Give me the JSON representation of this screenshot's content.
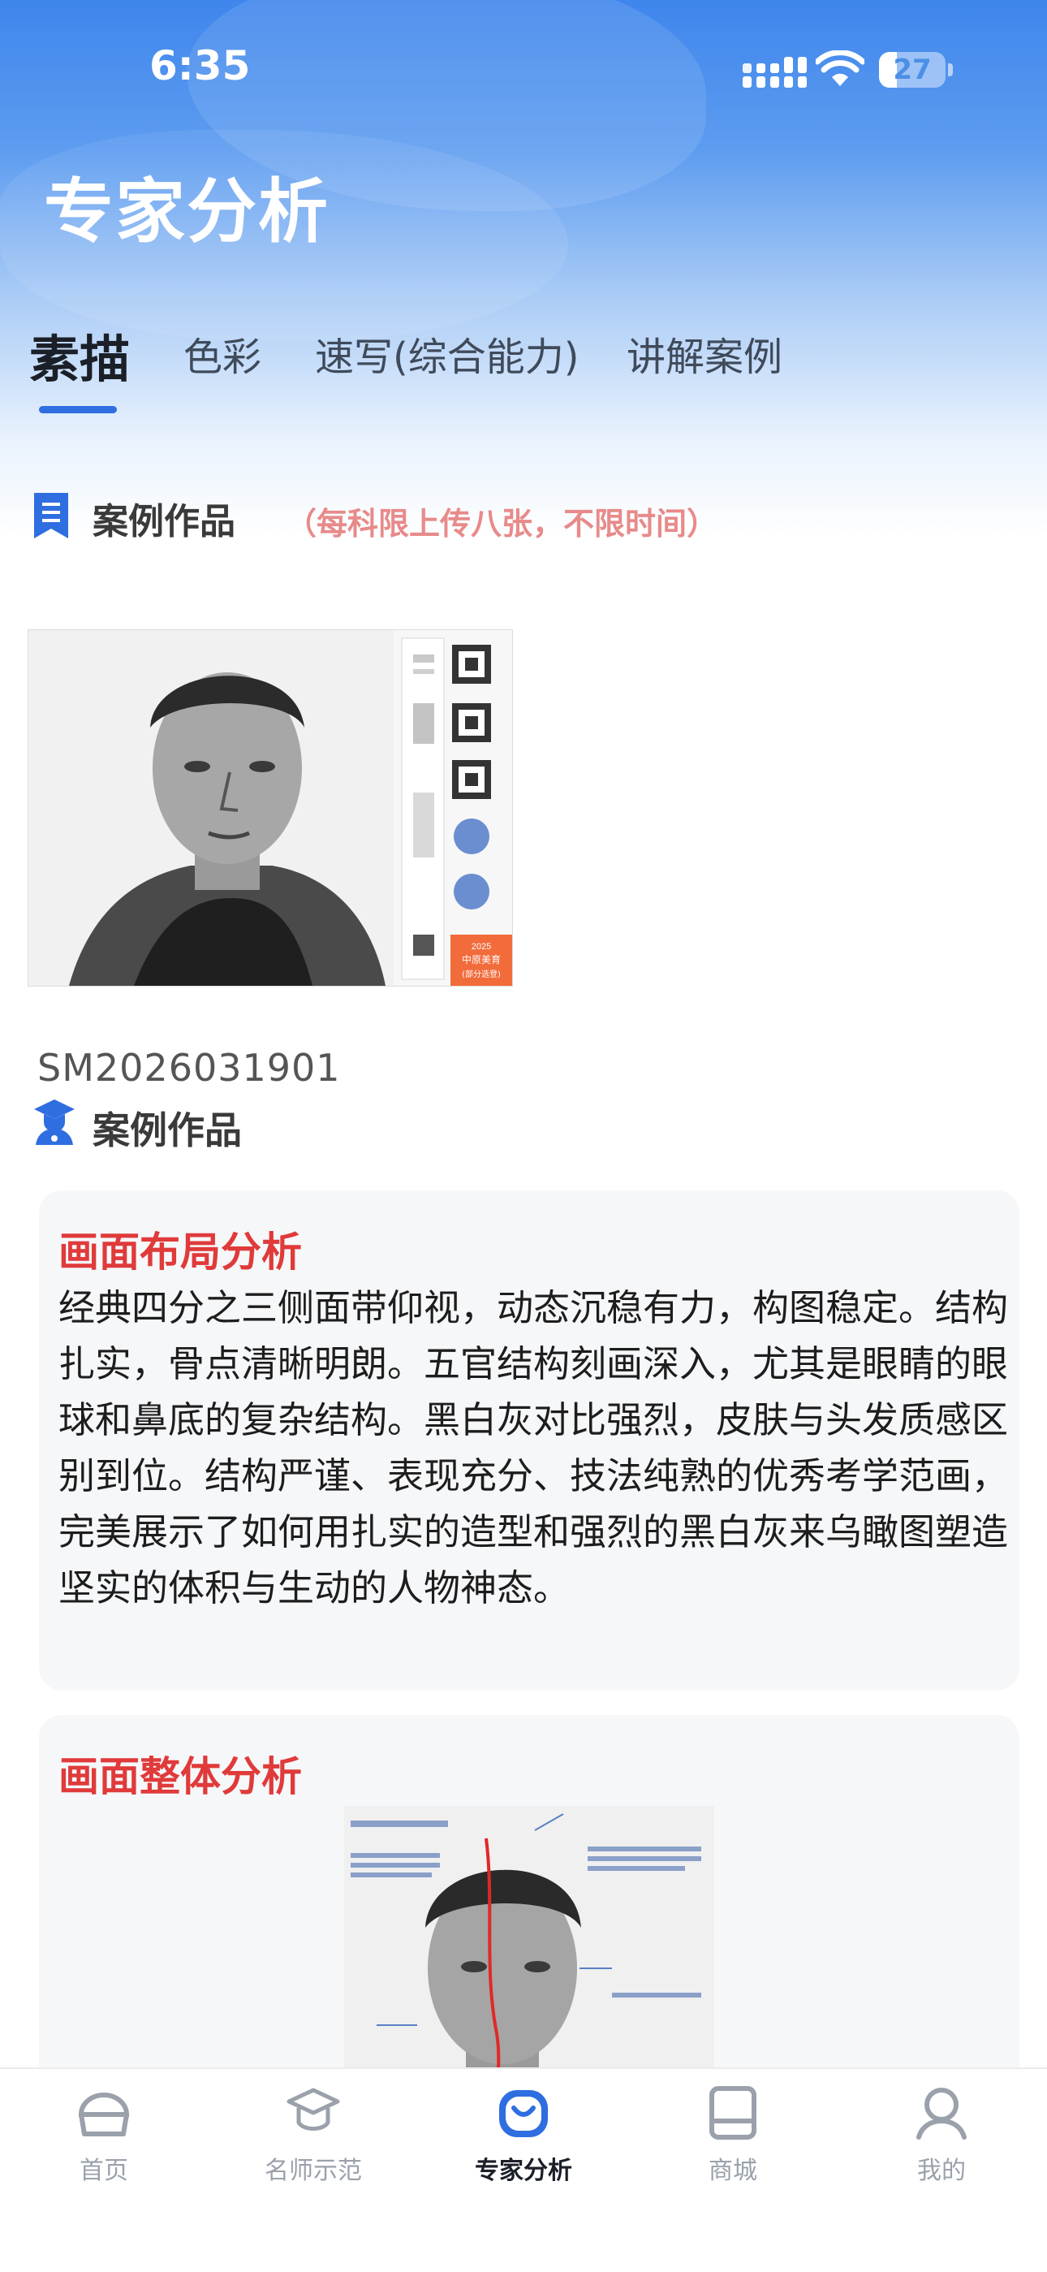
{
  "status_bar": {
    "time": "6:35",
    "battery": "27",
    "battery_level": 0.27
  },
  "header": {
    "title": "专家分析"
  },
  "tabs": [
    {
      "label": "素描",
      "active": true
    },
    {
      "label": "色彩",
      "active": false
    },
    {
      "label": "速写(综合能力)",
      "active": false
    },
    {
      "label": "讲解案例",
      "active": false
    }
  ],
  "section": {
    "title": "案例作品",
    "note": "（每科限上传八张，不限时间）"
  },
  "case": {
    "id": "SM2026031901",
    "label": "案例作品",
    "thumbnail": {
      "badge_year": "2025",
      "badge_text": "中原美育",
      "badge_sub": "(部分选登)"
    }
  },
  "layout_analysis": {
    "title": "画面布局分析",
    "body": "经典四分之三侧面带仰视，动态沉稳有力，构图稳定。结构扎实，骨点清晰明朗。五官结构刻画深入，尤其是眼睛的眼球和鼻底的复杂结构。黑白灰对比强烈，皮肤与头发质感区别到位。结构严谨、表现充分、技法纯熟的优秀考学范画，完美展示了如何用扎实的造型和强烈的黑白灰来乌瞰图塑造坚实的体积与生动的人物神态。"
  },
  "overall_analysis": {
    "title": "画面整体分析"
  },
  "tabbar": [
    {
      "label": "首页",
      "icon": "home-icon",
      "active": false
    },
    {
      "label": "名师示范",
      "icon": "graduation-cap-icon",
      "active": false
    },
    {
      "label": "专家分析",
      "icon": "analysis-bag-icon",
      "active": true
    },
    {
      "label": "商城",
      "icon": "book-icon",
      "active": false
    },
    {
      "label": "我的",
      "icon": "user-icon",
      "active": false
    }
  ],
  "colors": {
    "brand_blue": "#2f6ee0",
    "analysis_red": "#e03a3a",
    "note_pink": "#e88a8a",
    "badge_orange": "#f26b3a"
  }
}
